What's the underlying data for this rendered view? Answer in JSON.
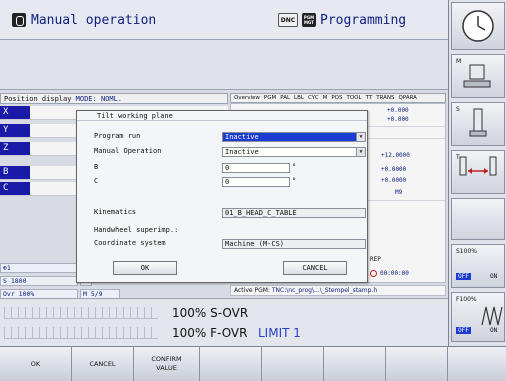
{
  "header": {
    "left_mode": "Manual operation",
    "right_mode": "Programming",
    "dnc_badge": "DNC",
    "pgm_badge_line1": "PGM",
    "pgm_badge_line2": "MGT"
  },
  "position_display": {
    "label": "Position display",
    "mode_label": "MODE: NOML.",
    "axes": [
      "X",
      "Y",
      "Z",
      "B",
      "C"
    ]
  },
  "overview": {
    "tabs": [
      "Overview",
      "PGM",
      "PAL",
      "LBL",
      "CYC",
      "M",
      "POS",
      "TOOL",
      "TT",
      "TRANS",
      "QPARA"
    ],
    "values": [
      "+0.000",
      "+0.000",
      "+12.0000",
      "+0.0000",
      "+0.0000",
      "M9"
    ],
    "rep_label": "REP",
    "timer": "00:00:00",
    "active_pgm_label": "Active PGM:",
    "active_pgm_path": "TNC:\\nc_prog\\...\\_Stempel_stamp.h"
  },
  "status": {
    "tool_number": "1",
    "t_label": "T",
    "spindle": "S 1800",
    "f_label": "F",
    "ovr": "Ovr 100%",
    "m_code": "M 5/9"
  },
  "overrides": {
    "s_ovr": "100% S-OVR",
    "f_ovr": "100% F-OVR",
    "limit": "LIMIT 1"
  },
  "dialog": {
    "title": "Tilt working plane",
    "program_run_label": "Program run",
    "program_run_value": "Inactive",
    "manual_operation_label": "Manual Operation",
    "manual_operation_value": "Inactive",
    "b_label": "B",
    "b_value": "0",
    "c_label": "C",
    "c_value": "0",
    "degree_symbol": "°",
    "kinematics_label": "Kinematics",
    "kinematics_value": "01_B_HEAD_C_TABLE",
    "handwheel_label": "Handwheel superimp.:",
    "coordinate_system_label": "Coordinate system",
    "coordinate_system_value": "Machine (M-CS)",
    "ok_button": "OK",
    "cancel_button": "CANCEL"
  },
  "softkeys": [
    {
      "label": "OK"
    },
    {
      "label": "CANCEL"
    },
    {
      "label": "CONFIRM VALUE"
    },
    {
      "label": ""
    },
    {
      "label": ""
    },
    {
      "label": ""
    },
    {
      "label": ""
    },
    {
      "label": ""
    }
  ],
  "sidebar": {
    "m_label": "M",
    "s_label": "S",
    "t_label": "T",
    "s_override": "S100%",
    "f_override": "F100%",
    "off": "OFF",
    "on": "ON"
  },
  "colors": {
    "accent_blue": "#1a1aa8",
    "selected_field": "#1a3cd0",
    "mode_text": "#102080",
    "limit_text": "#2a40c8"
  }
}
